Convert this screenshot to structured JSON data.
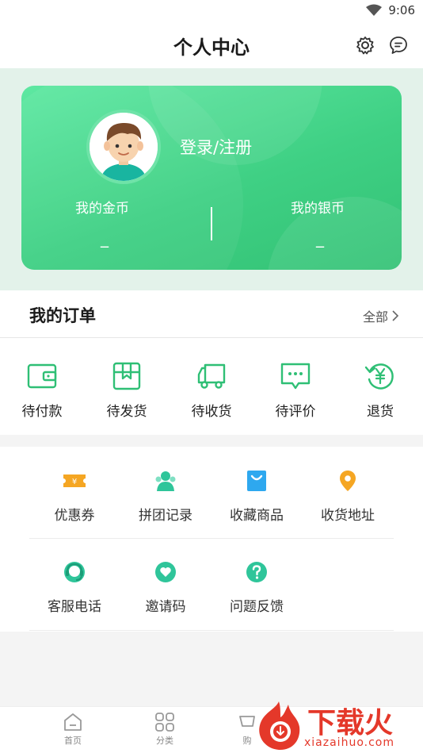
{
  "status": {
    "time": "9:06"
  },
  "header": {
    "title": "个人中心"
  },
  "profile": {
    "login_text": "登录/注册",
    "gold_label": "我的金币",
    "gold_value": "_",
    "silver_label": "我的银币",
    "silver_value": "_"
  },
  "orders": {
    "title": "我的订单",
    "all_label": "全部",
    "items": [
      {
        "label": "待付款",
        "icon": "wallet-icon"
      },
      {
        "label": "待发货",
        "icon": "package-icon"
      },
      {
        "label": "待收货",
        "icon": "truck-icon"
      },
      {
        "label": "待评价",
        "icon": "comment-icon"
      },
      {
        "label": "退货",
        "icon": "refund-icon"
      }
    ]
  },
  "services": {
    "items": [
      {
        "label": "优惠券",
        "icon": "coupon-icon"
      },
      {
        "label": "拼团记录",
        "icon": "group-icon"
      },
      {
        "label": "收藏商品",
        "icon": "bag-icon"
      },
      {
        "label": "收货地址",
        "icon": "location-icon"
      },
      {
        "label": "客服电话",
        "icon": "headset-icon"
      },
      {
        "label": "邀请码",
        "icon": "heart-icon"
      },
      {
        "label": "问题反馈",
        "icon": "question-icon"
      }
    ]
  },
  "tabbar": {
    "items": [
      {
        "label": "首页",
        "icon": "home-icon"
      },
      {
        "label": "分类",
        "icon": "grid-icon"
      },
      {
        "label": "购",
        "icon": "cart-icon"
      }
    ]
  },
  "watermark": {
    "text": "下载火",
    "sub": "xiazaihuo.com"
  },
  "colors": {
    "accent": "#2fbf75",
    "card_start": "#5ee8a2",
    "card_end": "#33c275",
    "watermark": "#e4382a"
  }
}
